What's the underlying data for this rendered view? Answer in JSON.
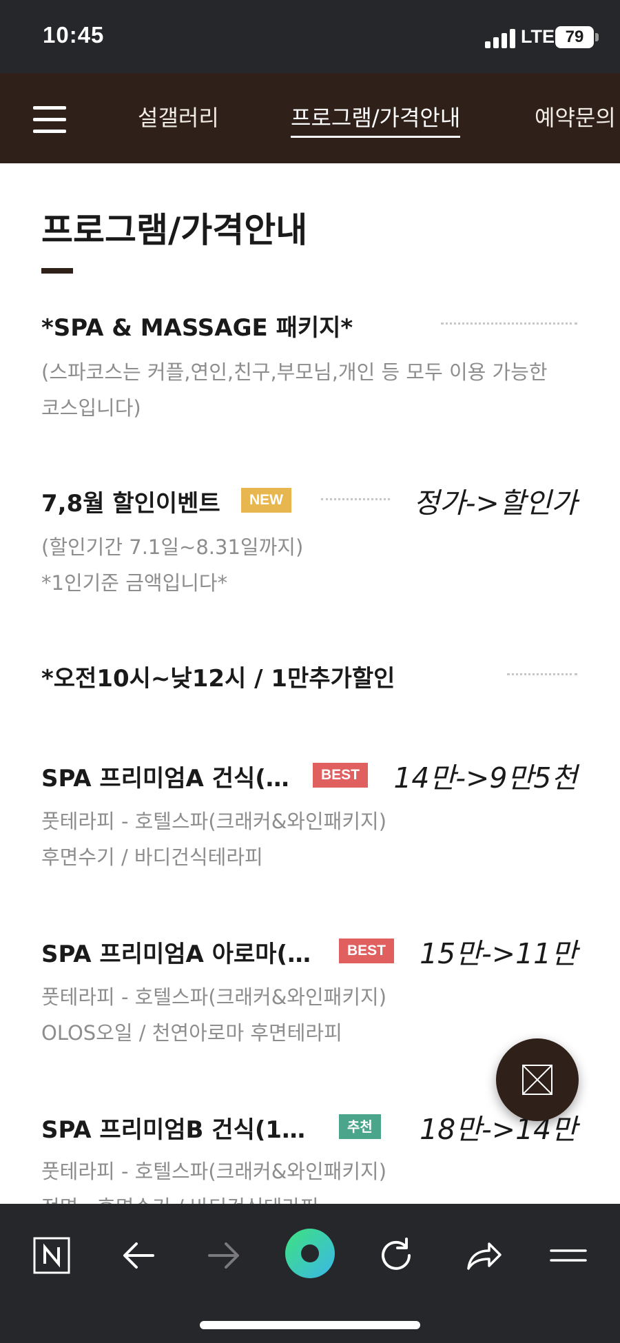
{
  "status_bar": {
    "time": "10:45",
    "network": "LTE",
    "battery": "79"
  },
  "nav": {
    "items": [
      {
        "label": "설갤러리"
      },
      {
        "label": "프로그램/가격안내"
      },
      {
        "label": "예약문의"
      }
    ],
    "active_index": 1
  },
  "page": {
    "title": "프로그램/가격안내"
  },
  "intro": {
    "title": "*SPA & MASSAGE 패키지*",
    "desc_line1": "(스파코스는 커플,연인,친구,부모님,개인 등 모두 이용 가능한",
    "desc_line2": " 코스입니다)"
  },
  "event": {
    "title": "7,8월 할인이벤트",
    "badge": "NEW",
    "price_header": "정가->할인가",
    "line1": "(할인기간 7.1일~8.31일까지)",
    "line2": "*1인기준 금액입니다*"
  },
  "morning": {
    "title": "*오전10시~낮12시 / 1만추가할인"
  },
  "items": [
    {
      "name": "SPA 프리미엄A 건식(…",
      "badge": "BEST",
      "price": "14만->9만5천",
      "line1": "풋테라피 - 호텔스파(크래커&와인패키지)",
      "line2": "후면수기 / 바디건식테라피"
    },
    {
      "name": "SPA 프리미엄A 아로마(…",
      "badge": "BEST",
      "price": "15만->11만",
      "line1": "풋테라피 - 호텔스파(크래커&와인패키지)",
      "line2": "OLOS오일 / 천연아로마 후면테라피"
    },
    {
      "name": "SPA 프리미엄B 건식(1…",
      "badge": "추천",
      "price": "18만->14만",
      "line1": "풋테라피 - 호텔스파(크래커&와인패키지)",
      "line2": "전면 · 후면수기 / 바디건식테라피"
    }
  ],
  "colors": {
    "header_bg": "#2f2119",
    "badge_new": "#e8b64e",
    "badge_best": "#e05f5f",
    "badge_recommend": "#4aa58a"
  },
  "toolbar_icons": [
    "naver-n-icon",
    "back-arrow-icon",
    "forward-arrow-icon",
    "green-dot-icon",
    "refresh-icon",
    "share-icon",
    "menu-icon"
  ]
}
